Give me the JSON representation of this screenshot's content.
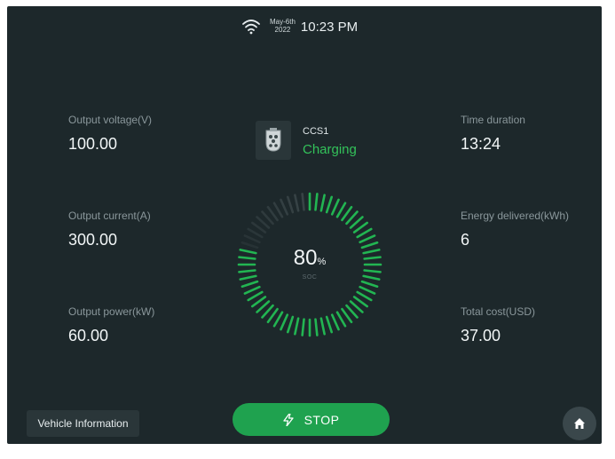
{
  "status_bar": {
    "date_line1": "May-6th",
    "date_line2": "2022",
    "time": "10:23 PM"
  },
  "metrics_left": [
    {
      "label": "Output voltage(V)",
      "value": "100.00"
    },
    {
      "label": "Output current(A)",
      "value": "300.00"
    },
    {
      "label": "Output power(kW)",
      "value": "60.00"
    }
  ],
  "metrics_right": [
    {
      "label": "Time duration",
      "value": "13:24"
    },
    {
      "label": "Energy delivered(kWh)",
      "value": "6"
    },
    {
      "label": "Total cost(USD)",
      "value": "37.00"
    }
  ],
  "connector": {
    "name": "CCS1",
    "status": "Charging",
    "icon": "ev-connector-icon"
  },
  "soc": {
    "value": "80",
    "unit": "%",
    "label": "SOC",
    "level_fraction": 0.8
  },
  "buttons": {
    "vehicle_info": "Vehicle Information",
    "stop": "STOP",
    "home_icon": "home-icon"
  },
  "colors": {
    "background": "#1d282b",
    "accent_green": "#1fa24f",
    "charging_text": "#33c25a",
    "gauge_active": "#22b552",
    "gauge_inactive": "#3b474a"
  }
}
